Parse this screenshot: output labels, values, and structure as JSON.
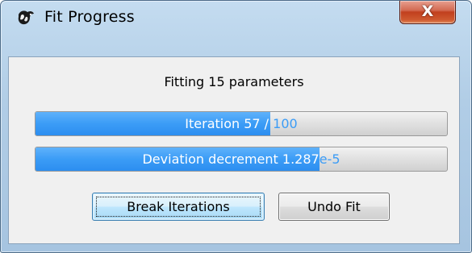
{
  "window": {
    "title": "Fit Progress",
    "close_glyph": "X",
    "app_icon": "bird-icon"
  },
  "main": {
    "heading": "Fitting 15 parameters",
    "progress_bars": [
      {
        "text": "Iteration 57 / 100",
        "fraction": 0.57
      },
      {
        "text": "Deviation decrement 1.287e-5",
        "fraction": 0.69
      }
    ],
    "buttons": {
      "break_label": "Break Iterations",
      "undo_label": "Undo Fit"
    }
  },
  "colors": {
    "progress_fill": "#3b9cf6",
    "titlebar": "#b1cde6",
    "close_button": "#c1401e"
  }
}
